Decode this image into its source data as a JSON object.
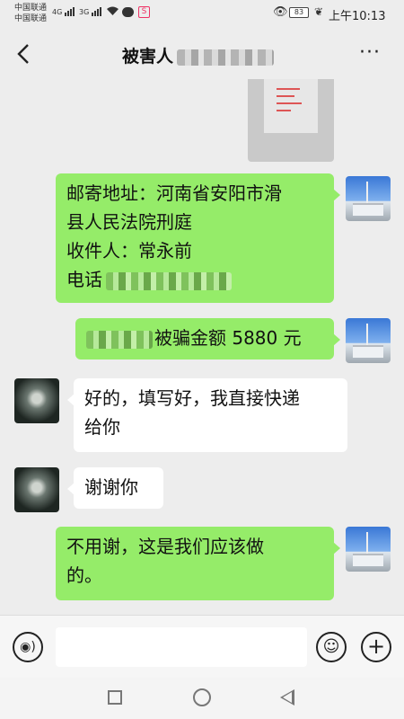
{
  "status_bar": {
    "carrier_1": "中国联通",
    "carrier_2": "中国联通",
    "signal_1_label": "4G",
    "signal_2_label": "3G",
    "battery": "83",
    "time": "上午10:13",
    "icons": [
      "wifi-icon",
      "message-icon",
      "app-notification-icon",
      "eye-icon",
      "battery-icon",
      "leaf-icon"
    ]
  },
  "header": {
    "title": "被害人",
    "back_icon": "chevron-left-icon",
    "more_icon": "more-dots-icon",
    "more_label": "···"
  },
  "messages": [
    {
      "side": "right",
      "type": "image"
    },
    {
      "side": "right",
      "type": "text",
      "lines": [
        "邮寄地址：河南省安阳市滑",
        "县人民法院刑庭",
        "收件人：常永前",
        "电话"
      ]
    },
    {
      "side": "right",
      "type": "text",
      "lines": [
        "被骗金额 5880 元"
      ]
    },
    {
      "side": "left",
      "type": "text",
      "lines": [
        "好的，填写好，我直接快递",
        "给你"
      ]
    },
    {
      "side": "left",
      "type": "text",
      "lines": [
        "谢谢你"
      ]
    },
    {
      "side": "right",
      "type": "text",
      "lines": [
        "不用谢，这是我们应该做",
        "的。"
      ]
    }
  ],
  "input_bar": {
    "voice_icon": "voice-icon",
    "voice_glyph": "◉)",
    "emoji_icon": "emoji-icon",
    "emoji_glyph": "☺",
    "plus_icon": "plus-icon",
    "plus_glyph": "+",
    "input_value": ""
  },
  "system_nav": {
    "buttons": [
      "recents-square-icon",
      "home-circle-icon",
      "back-triangle-icon"
    ]
  },
  "colors": {
    "background": "#ededed",
    "sent_bubble": "#95ec69",
    "received_bubble": "#ffffff"
  }
}
